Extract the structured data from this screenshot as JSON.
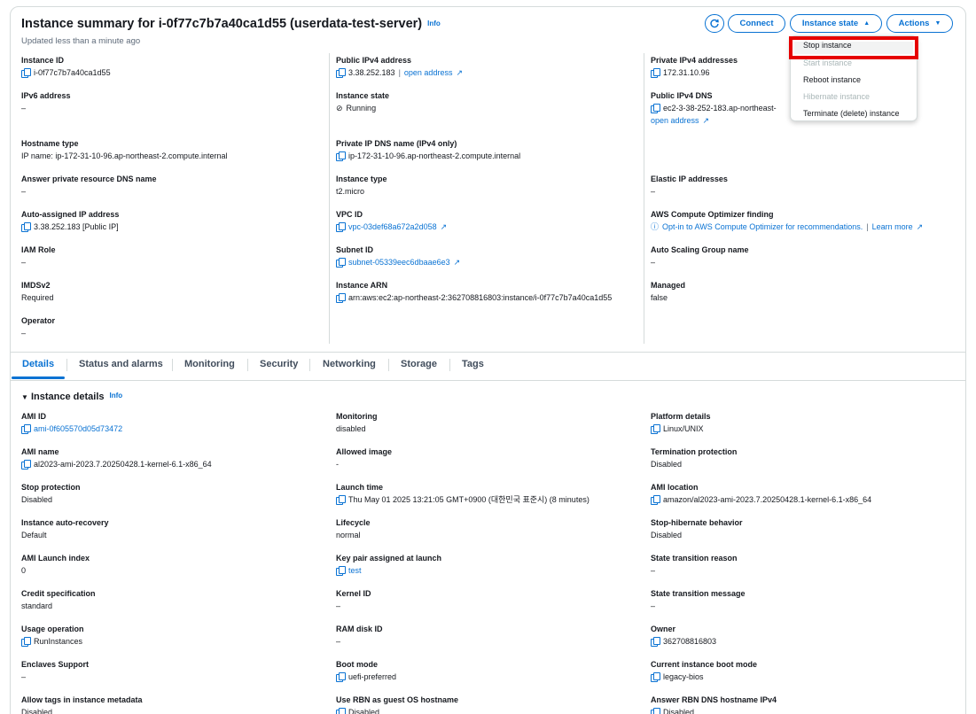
{
  "header": {
    "title": "Instance summary for i-0f77c7b7a40ca1d55 (userdata-test-server)",
    "info": "Info",
    "updated": "Updated less than a minute ago",
    "connect": "Connect",
    "instance_state": "Instance state",
    "actions": "Actions"
  },
  "menu": {
    "items": [
      {
        "label": "Stop instance",
        "enabled": true
      },
      {
        "label": "Start instance",
        "enabled": false
      },
      {
        "label": "Reboot instance",
        "enabled": true
      },
      {
        "label": "Hibernate instance",
        "enabled": false
      },
      {
        "label": "Terminate (delete) instance",
        "enabled": true
      }
    ]
  },
  "summary": {
    "instance_id": {
      "label": "Instance ID",
      "value": "i-0f77c7b7a40ca1d55"
    },
    "public_ipv4": {
      "label": "Public IPv4 address",
      "value": "3.38.252.183",
      "sep": "|",
      "link": "open address"
    },
    "private_ipv4": {
      "label": "Private IPv4 addresses",
      "value": "172.31.10.96"
    },
    "ipv6": {
      "label": "IPv6 address",
      "value": "–"
    },
    "instance_state": {
      "label": "Instance state",
      "value": "Running"
    },
    "public_dns": {
      "label": "Public IPv4 DNS",
      "value": "ec2-3-38-252-183.ap-northeast-",
      "link": "open address"
    },
    "hostname_type": {
      "label": "Hostname type",
      "value": "IP name: ip-172-31-10-96.ap-northeast-2.compute.internal"
    },
    "private_dns": {
      "label": "Private IP DNS name (IPv4 only)",
      "value": "ip-172-31-10-96.ap-northeast-2.compute.internal"
    },
    "answer_dns": {
      "label": "Answer private resource DNS name",
      "value": "–"
    },
    "instance_type": {
      "label": "Instance type",
      "value": "t2.micro"
    },
    "elastic_ip": {
      "label": "Elastic IP addresses",
      "value": "–"
    },
    "auto_ip": {
      "label": "Auto-assigned IP address",
      "value": "3.38.252.183 [Public IP]"
    },
    "vpc_id": {
      "label": "VPC ID",
      "value": "vpc-03def68a672a2d058"
    },
    "optimizer": {
      "label": "AWS Compute Optimizer finding",
      "value": "Opt-in to AWS Compute Optimizer for recommendations.",
      "sep": "|",
      "link": "Learn more"
    },
    "iam_role": {
      "label": "IAM Role",
      "value": "–"
    },
    "subnet_id": {
      "label": "Subnet ID",
      "value": "subnet-05339eec6dbaae6e3"
    },
    "asg_name": {
      "label": "Auto Scaling Group name",
      "value": "–"
    },
    "imdsv2": {
      "label": "IMDSv2",
      "value": "Required"
    },
    "instance_arn": {
      "label": "Instance ARN",
      "value": "arn:aws:ec2:ap-northeast-2:362708816803:instance/i-0f77c7b7a40ca1d55"
    },
    "managed": {
      "label": "Managed",
      "value": "false"
    },
    "operator": {
      "label": "Operator",
      "value": "–"
    }
  },
  "tabs": [
    "Details",
    "Status and alarms",
    "Monitoring",
    "Security",
    "Networking",
    "Storage",
    "Tags"
  ],
  "details": {
    "title": "Instance details",
    "info": "Info",
    "ami_id": {
      "label": "AMI ID",
      "value": "ami-0f605570d05d73472"
    },
    "monitoring": {
      "label": "Monitoring",
      "value": "disabled"
    },
    "platform": {
      "label": "Platform details",
      "value": "Linux/UNIX"
    },
    "ami_name": {
      "label": "AMI name",
      "value": "al2023-ami-2023.7.20250428.1-kernel-6.1-x86_64"
    },
    "allowed_image": {
      "label": "Allowed image",
      "value": "-"
    },
    "termination": {
      "label": "Termination protection",
      "value": "Disabled"
    },
    "stop_protection": {
      "label": "Stop protection",
      "value": "Disabled"
    },
    "launch_time": {
      "label": "Launch time",
      "value": "Thu May 01 2025 13:21:05 GMT+0900 (대한민국 표준시) (8 minutes)"
    },
    "ami_location": {
      "label": "AMI location",
      "value": "amazon/al2023-ami-2023.7.20250428.1-kernel-6.1-x86_64"
    },
    "auto_recovery": {
      "label": "Instance auto-recovery",
      "value": "Default"
    },
    "lifecycle": {
      "label": "Lifecycle",
      "value": "normal"
    },
    "stop_hibernate": {
      "label": "Stop-hibernate behavior",
      "value": "Disabled"
    },
    "ami_launch_index": {
      "label": "AMI Launch index",
      "value": "0"
    },
    "key_pair": {
      "label": "Key pair assigned at launch",
      "value": "test"
    },
    "transition_reason": {
      "label": "State transition reason",
      "value": "–"
    },
    "credit_spec": {
      "label": "Credit specification",
      "value": "standard"
    },
    "kernel_id": {
      "label": "Kernel ID",
      "value": "–"
    },
    "transition_msg": {
      "label": "State transition message",
      "value": "–"
    },
    "usage_op": {
      "label": "Usage operation",
      "value": "RunInstances"
    },
    "ram_disk": {
      "label": "RAM disk ID",
      "value": "–"
    },
    "owner": {
      "label": "Owner",
      "value": "362708816803"
    },
    "enclaves": {
      "label": "Enclaves Support",
      "value": "–"
    },
    "boot_mode": {
      "label": "Boot mode",
      "value": "uefi-preferred"
    },
    "current_boot": {
      "label": "Current instance boot mode",
      "value": "legacy-bios"
    },
    "allow_tags": {
      "label": "Allow tags in instance metadata",
      "value": "Disabled"
    },
    "rbn_guest": {
      "label": "Use RBN as guest OS hostname",
      "value": "Disabled"
    },
    "rbn_answer": {
      "label": "Answer RBN DNS hostname IPv4",
      "value": "Disabled"
    }
  },
  "colors": {
    "accent": "#0972d3",
    "success": "#037f0c",
    "highlight": "#e60000"
  }
}
